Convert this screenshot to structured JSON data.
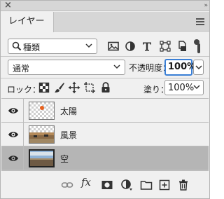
{
  "panel": {
    "close_glyph": "×",
    "collapse_glyph": "»",
    "tab_label": "レイヤー"
  },
  "filter": {
    "kind_value": "種類",
    "icons": [
      "search-icon",
      "image-filter-icon",
      "adjustment-filter-icon",
      "text-filter-icon",
      "shape-filter-icon",
      "smart-object-filter-icon",
      "filter-toggle-icon"
    ]
  },
  "blend": {
    "mode_value": "通常",
    "opacity_label": "不透明度：",
    "opacity_value": "100%"
  },
  "lock": {
    "label": "ロック：",
    "icons": [
      "lock-transparent-pixels-icon",
      "lock-image-pixels-icon",
      "lock-position-icon",
      "lock-artboard-icon",
      "lock-all-icon"
    ],
    "fill_label": "塗り：",
    "fill_value": "100%"
  },
  "layers": [
    {
      "name": "太陽",
      "visible": true,
      "selected": false
    },
    {
      "name": "風景",
      "visible": true,
      "selected": false
    },
    {
      "name": "空",
      "visible": true,
      "selected": true
    }
  ],
  "toolbar": {
    "fx_label": "fx",
    "icons": [
      "link-layers-icon",
      "layer-style-icon",
      "add-mask-icon",
      "adjustment-layer-icon",
      "new-group-icon",
      "new-layer-icon",
      "delete-layer-icon"
    ]
  },
  "colors": {
    "selection_highlight": "#3a7fd6",
    "selected_layer_bg": "#b5b5b5",
    "sun_dot": "#e8611e"
  }
}
